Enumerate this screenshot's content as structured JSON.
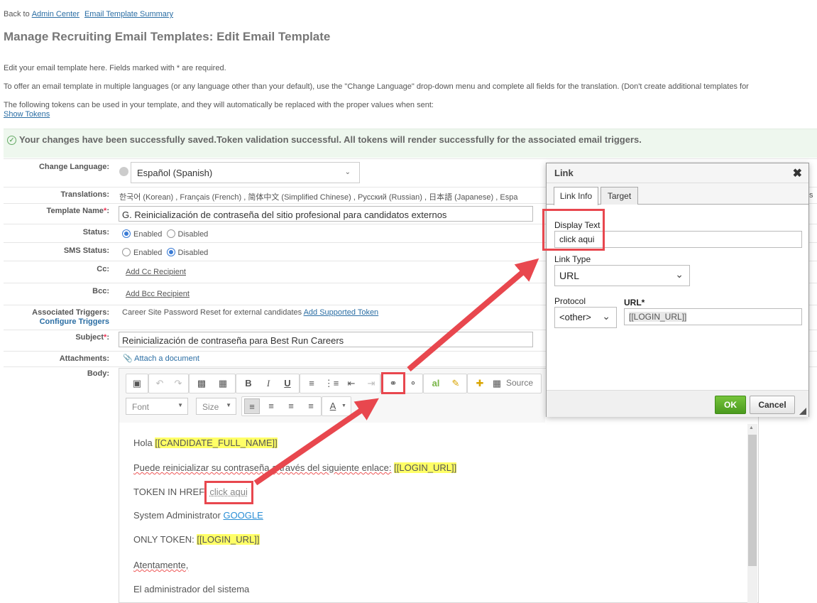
{
  "breadcrumb": {
    "back_prefix": "Back to",
    "admin_center": "Admin Center",
    "summary": "Email Template Summary"
  },
  "page_title": "Manage Recruiting Email Templates: Edit Email Template",
  "intro": {
    "line1": "Edit your email template here. Fields marked with * are required.",
    "line2": "To offer an email template in multiple languages (or any language other than your default), use the \"Change Language\" drop-down menu and complete all fields for the translation. (Don't create additional templates for",
    "line3": "The following tokens can be used in your template, and they will automatically be replaced with the proper values when sent:",
    "show_tokens": "Show Tokens"
  },
  "success_message": "Your changes have been successfully saved.Token validation successful. All tokens will render successfully for the associated email triggers.",
  "form": {
    "change_language_label": "Change Language:",
    "language_value": "Español (Spanish)",
    "translations_label": "Translations:",
    "translations_value": "한국어 (Korean) , Français (French) , 简体中文 (Simplified Chinese) , Русский (Russian) , 日本語 (Japanese) , Espa",
    "translations_tail": "s",
    "template_name_label": "Template Name",
    "template_name_value": "G. Reinicialización de contraseña del sitio profesional para candidatos externos",
    "status_label": "Status:",
    "sms_status_label": "SMS Status:",
    "enabled": "Enabled",
    "disabled": "Disabled",
    "cc_label": "Cc:",
    "add_cc": "Add Cc Recipient",
    "bcc_label": "Bcc:",
    "add_bcc": "Add Bcc Recipient",
    "triggers_label": "Associated Triggers:",
    "configure_triggers": "Configure Triggers",
    "triggers_value": "Career Site Password Reset for external candidates",
    "add_supported_token": "Add Supported Token",
    "subject_label": "Subject",
    "subject_value": "Reinicialización de contraseña para Best Run Careers",
    "attachments_label": "Attachments:",
    "attach_document": "Attach a document",
    "body_label": "Body:",
    "required_mark": "*",
    "colon": ":"
  },
  "toolbar": {
    "source_label": "Source",
    "font_label": "Font",
    "size_label": "Size"
  },
  "body": {
    "hola": "Hola",
    "token_candidate": "[[CANDIDATE_FULL_NAME]]",
    "line2_a": "Puede reinicializar su contraseña a través del siguiente enlace:",
    "token_login": "[[LOGIN_URL]]",
    "line3_a": "TOKEN IN HREF:",
    "click_aqui": "click aqui",
    "line4_a": "System Administrator",
    "google": "GOOGLE",
    "line5_a": "ONLY TOKEN:",
    "atentamente": "Atentamente,",
    "admin": "El administrador del sistema"
  },
  "dialog": {
    "title": "Link",
    "tab_link_info": "Link Info",
    "tab_target": "Target",
    "display_text_label": "Display Text",
    "display_text_value": "click aqui",
    "link_type_label": "Link Type",
    "link_type_value": "URL",
    "protocol_label": "Protocol",
    "protocol_value": "<other>",
    "url_label": "URL*",
    "url_value": "[[LOGIN_URL]]",
    "ok": "OK",
    "cancel": "Cancel"
  },
  "colors": {
    "accent_red": "#e8474e",
    "token_yellow": "#ffff66",
    "ok_green": "#5aad27",
    "link_blue": "#2b6ea4"
  }
}
